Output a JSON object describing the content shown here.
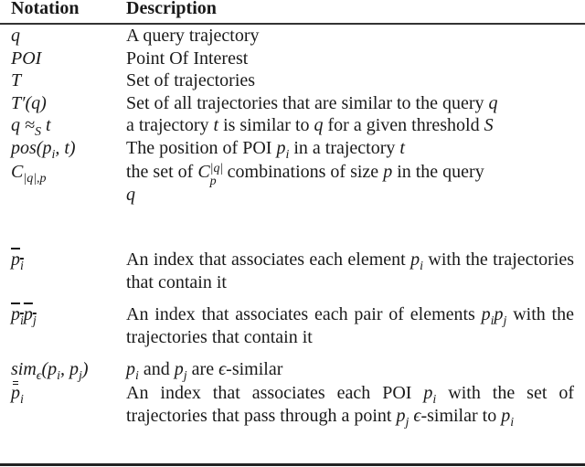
{
  "table": {
    "headers": {
      "notation": "Notation",
      "description": "Description"
    },
    "rows": [
      {
        "notation": "q",
        "description": "A query trajectory"
      },
      {
        "notation": "POI",
        "description": "Point Of Interest"
      },
      {
        "notation": "T",
        "description": "Set of trajectories"
      },
      {
        "notation": "T′(q)",
        "description_parts": [
          "Set of all trajectories that are similar to the query ",
          "q"
        ]
      },
      {
        "notation_parts": [
          "q ≈",
          "S",
          " t"
        ],
        "description_parts": [
          "a trajectory ",
          "t",
          " is similar to ",
          "q",
          " for a given threshold ",
          "S"
        ]
      },
      {
        "notation_parts": [
          "pos(p",
          "i",
          ", t)"
        ],
        "description_parts": [
          "The position of POI ",
          "p",
          "i",
          " in a trajectory ",
          "t"
        ]
      },
      {
        "notation_parts": [
          "C",
          "|q|,p"
        ],
        "description_parts": [
          "the set of ",
          "C",
          "p",
          "|q|",
          " combinations of size ",
          "p",
          " in the query ",
          "q"
        ]
      },
      {
        "notation_parts": [
          "p",
          "i"
        ],
        "notation_style": "overline",
        "description_parts": [
          "An index that associates each element ",
          "p",
          "i",
          " with the trajectories that contain it"
        ]
      },
      {
        "notation_parts": [
          "p",
          "i",
          "p",
          "j"
        ],
        "notation_style": "overline",
        "description_parts": [
          "An index that associates each pair of elements ",
          "p",
          "i",
          "p",
          "j",
          " with the trajectories that contain it"
        ]
      },
      {
        "notation_parts": [
          "sim",
          "ϵ",
          "(p",
          "i",
          ", p",
          "j",
          ")"
        ],
        "description_parts": [
          "p",
          "i",
          " and ",
          "p",
          "j",
          " are ",
          "ϵ",
          "-similar"
        ]
      },
      {
        "notation_parts": [
          "p",
          "i"
        ],
        "notation_style": "double-bar",
        "description_parts": [
          "An index that associates each POI ",
          "p",
          "i",
          " with the set of trajectories that pass through a point ",
          "p",
          "j",
          " ",
          "ϵ",
          "-similar to ",
          "p",
          "i"
        ]
      }
    ]
  }
}
